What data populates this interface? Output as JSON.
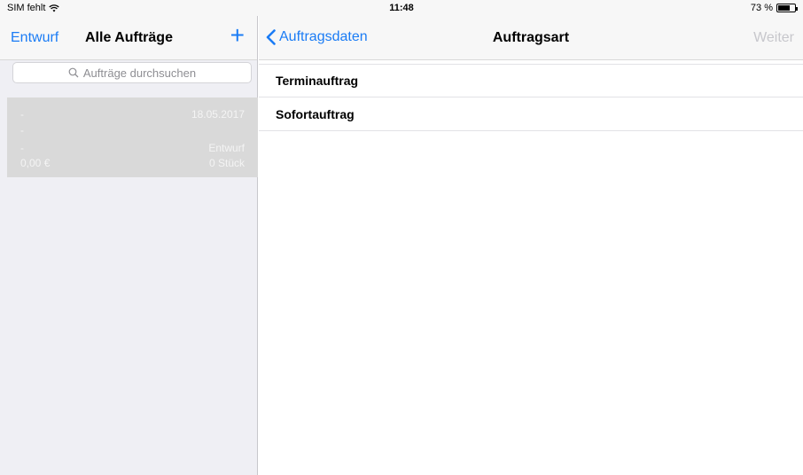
{
  "status_bar": {
    "carrier": "SIM fehlt",
    "time": "11:48",
    "battery_text": "73 %",
    "battery_level_percent": 73
  },
  "master": {
    "left_button": "Entwurf",
    "title": "Alle Aufträge",
    "add_icon": "plus-icon",
    "search_placeholder": "Aufträge durchsuchen",
    "order": {
      "line1_left": "-",
      "date": "18.05.2017",
      "line2_left": "-",
      "line3_left": "-",
      "status": "Entwurf",
      "amount": "0,00 €",
      "quantity": "0 Stück"
    }
  },
  "detail": {
    "back_label": "Auftragsdaten",
    "title": "Auftragsart",
    "next_label": "Weiter",
    "options": [
      "Terminauftrag",
      "Sofortauftrag"
    ]
  },
  "colors": {
    "accent": "#1b7cf5",
    "disabled": "#c7c7cc",
    "selected_cell": "#d9d9d9"
  }
}
